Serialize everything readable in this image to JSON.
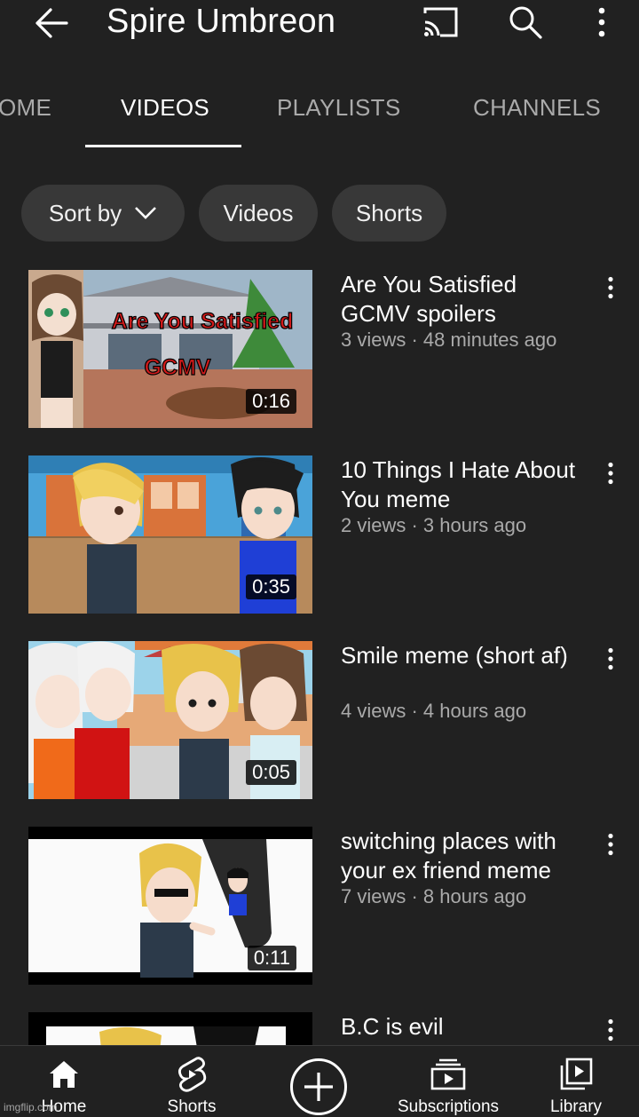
{
  "header": {
    "channel_name": "Spire Umbreon",
    "back_icon": "arrow-left-icon",
    "cast_icon": "cast-icon",
    "search_icon": "search-icon",
    "more_icon": "more-vert-icon"
  },
  "tabs": [
    {
      "label": "OME",
      "active": false
    },
    {
      "label": "VIDEOS",
      "active": true
    },
    {
      "label": "PLAYLISTS",
      "active": false
    },
    {
      "label": "CHANNELS",
      "active": false
    }
  ],
  "filters": {
    "sort_label": "Sort by",
    "videos_label": "Videos",
    "shorts_label": "Shorts"
  },
  "videos": [
    {
      "title": "Are You Satisfied GCMV spoilers",
      "meta": "3 views · 48 minutes ago",
      "duration": "0:16",
      "thumb_text_1": "Are You Satisfied",
      "thumb_text_2": "GCMV"
    },
    {
      "title": "10 Things I Hate About You meme",
      "meta": "2 views · 3 hours ago",
      "duration": "0:35"
    },
    {
      "title": "Smile meme (short af)",
      "meta": "4 views · 4 hours ago",
      "duration": "0:05"
    },
    {
      "title": "switching places with your ex friend meme",
      "meta": "7 views · 8 hours ago",
      "duration": "0:11"
    },
    {
      "title": "B.C is evil"
    }
  ],
  "bottom_nav": {
    "home": "Home",
    "shorts": "Shorts",
    "subscriptions": "Subscriptions",
    "library": "Library"
  },
  "watermark": "imgflip.com",
  "colors": {
    "background": "#212121",
    "chip": "#383838",
    "secondary_text": "#aaaaaa",
    "thumb_text_red": "#d11a1a"
  }
}
